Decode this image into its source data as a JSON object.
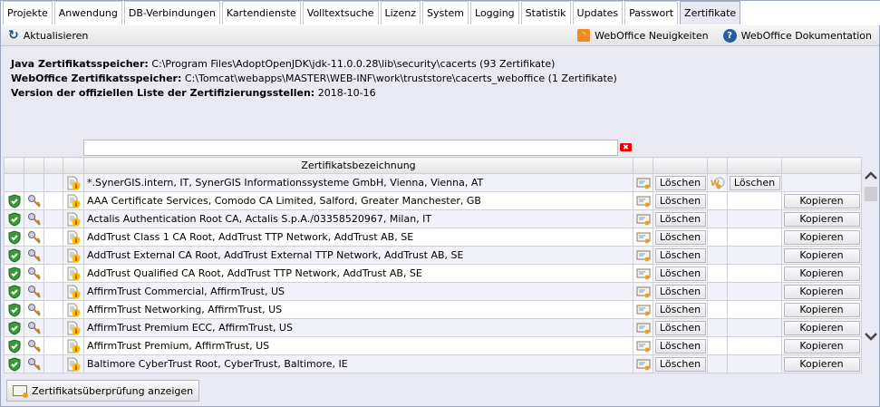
{
  "tabs": [
    "Projekte",
    "Anwendung",
    "DB-Verbindungen",
    "Kartendienste",
    "Volltextsuche",
    "Lizenz",
    "System",
    "Logging",
    "Statistik",
    "Updates",
    "Passwort",
    "Zertifikate"
  ],
  "active_tab": "Zertifikate",
  "toolbar": {
    "refresh": "Aktualisieren",
    "news": "WebOffice Neuigkeiten",
    "docs": "WebOffice Dokumentation"
  },
  "info": {
    "java_label": "Java Zertifikatsspeicher:",
    "java_value": "C:\\Program Files\\AdoptOpenJDK\\jdk-11.0.0.28\\lib\\security\\cacerts (93 Zertifikate)",
    "wo_label": "WebOffice Zertifikatsspeicher:",
    "wo_value": "C:\\Tomcat\\webapps\\MASTER\\WEB-INF\\work\\truststore\\cacerts_weboffice (1 Zertifikate)",
    "ver_label": "Version der offiziellen Liste der Zertifizierungsstellen:",
    "ver_value": "2018-10-16"
  },
  "filter": {
    "value": ""
  },
  "table": {
    "header": "Zertifikatsbezeichnung",
    "delete": "Löschen",
    "copy": "Kopieren",
    "rows": [
      {
        "name": "*.SynerGIS.intern, IT, SynerGIS Informationssysteme GmbH, Vienna, Vienna, AT",
        "trusted": false,
        "weboffice": true
      },
      {
        "name": "AAA Certificate Services, Comodo CA Limited, Salford, Greater Manchester, GB",
        "trusted": true,
        "weboffice": false
      },
      {
        "name": "Actalis Authentication Root CA, Actalis S.p.A./03358520967, Milan, IT",
        "trusted": true,
        "weboffice": false
      },
      {
        "name": "AddTrust Class 1 CA Root, AddTrust TTP Network, AddTrust AB, SE",
        "trusted": true,
        "weboffice": false
      },
      {
        "name": "AddTrust External CA Root, AddTrust External TTP Network, AddTrust AB, SE",
        "trusted": true,
        "weboffice": false
      },
      {
        "name": "AddTrust Qualified CA Root, AddTrust TTP Network, AddTrust AB, SE",
        "trusted": true,
        "weboffice": false
      },
      {
        "name": "AffirmTrust Commercial, AffirmTrust, US",
        "trusted": true,
        "weboffice": false
      },
      {
        "name": "AffirmTrust Networking, AffirmTrust, US",
        "trusted": true,
        "weboffice": false
      },
      {
        "name": "AffirmTrust Premium ECC, AffirmTrust, US",
        "trusted": true,
        "weboffice": false
      },
      {
        "name": "AffirmTrust Premium, AffirmTrust, US",
        "trusted": true,
        "weboffice": false
      },
      {
        "name": "Baltimore CyberTrust Root, CyberTrust, Baltimore, IE",
        "trusted": true,
        "weboffice": false
      }
    ]
  },
  "bottom_button": "Zertifikatsüberprüfung anzeigen"
}
